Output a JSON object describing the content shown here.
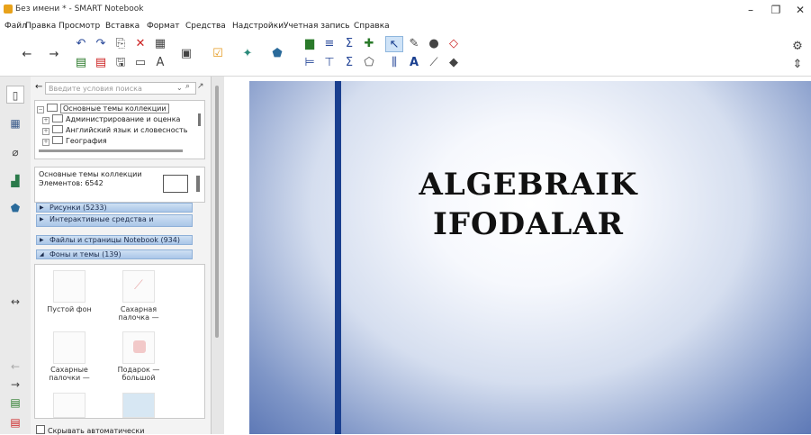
{
  "window": {
    "title": "Без имени * - SMART Notebook"
  },
  "menu": [
    "Файл",
    "Правка",
    "Просмотр",
    "Вставка",
    "Формат",
    "Средства",
    "Надстройки",
    "Учетная запись",
    "Справка"
  ],
  "toolbar": {
    "icons": [
      "back-arrow-icon",
      "forward-arrow-icon",
      "undo-icon",
      "redo-icon",
      "new-page-icon",
      "delete-icon",
      "table-icon",
      "screen-shade-icon",
      "tool-check-icon",
      "activity-icon",
      "insert-icon",
      "chart-icon",
      "align-icon",
      "math-sum-icon",
      "add-icon",
      "select-icon",
      "pen-icon",
      "fill-icon",
      "eraser-icon",
      "properties-icon",
      "text-icon",
      "line-icon",
      "shape-icon"
    ]
  },
  "left_strip": {
    "icons": [
      "page-sorter-icon",
      "gallery-icon",
      "attachments-icon",
      "properties-icon",
      "addons-icon",
      "resize-icon",
      "move-left-icon",
      "move-right-icon",
      "page-icon",
      "page-icon-2"
    ]
  },
  "gallery": {
    "search_placeholder": "Введите условия поиска",
    "tree": {
      "root": "Основные темы коллекции",
      "children": [
        "Администрирование и оценка",
        "Английский язык и словесность",
        "География"
      ]
    },
    "info": {
      "title": "Основные темы коллекции",
      "count": "Элементов: 6542"
    },
    "categories": [
      {
        "label": "Рисунки (5233)"
      },
      {
        "label": "Интерактивные средства и"
      },
      {
        "label": "Файлы и страницы Notebook (934)"
      },
      {
        "label": "Фоны и темы (139)"
      }
    ],
    "thumbs": [
      {
        "label1": "Пустой фон",
        "label2": ""
      },
      {
        "label1": "Сахарная",
        "label2": "палочка —"
      },
      {
        "label1": "Сахарные",
        "label2": "палочки —"
      },
      {
        "label1": "Подарок —",
        "label2": "большой"
      }
    ],
    "auto_hide": "Скрывать автоматически"
  },
  "slide": {
    "line1": "ALGEBRAIK",
    "line2": "IFODALAR",
    "accent": "#1a3f8f"
  }
}
